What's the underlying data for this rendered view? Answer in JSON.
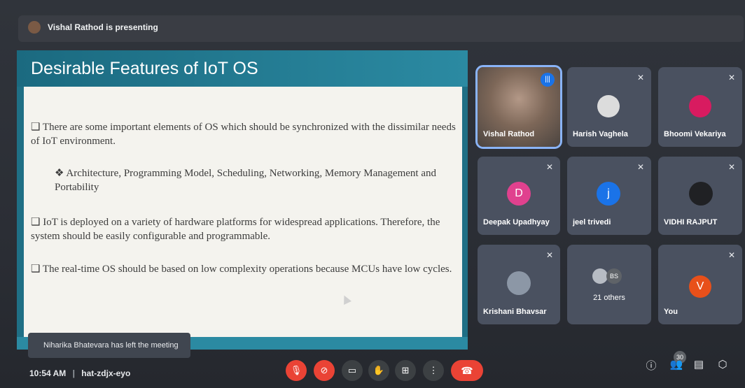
{
  "presenter_banner": {
    "text": "Vishal Rathod is presenting"
  },
  "slide": {
    "title": "Desirable Features of IoT OS",
    "paragraphs": [
      "❑ There are some important elements of OS which should be synchronized with the dissimilar needs of IoT environment.",
      "❖   Architecture, Programming Model, Scheduling, Networking, Memory Management and Portability",
      "❑ IoT is deployed on a variety of hardware platforms for widespread applications. Therefore, the system should be easily configurable and programmable.",
      "❑ The real-time OS should be based on low complexity operations because MCUs have low cycles."
    ]
  },
  "toast": {
    "text": "Niharika Bhatevara has left the meeting"
  },
  "participants": [
    {
      "name": "Vishal Rathod",
      "state": "speaking",
      "icon": "speaking-icon"
    },
    {
      "name": "Harish Vaghela",
      "state": "muted",
      "icon": "mic-off-icon"
    },
    {
      "name": "Bhoomi Vekariya",
      "state": "muted",
      "icon": "mic-off-icon"
    },
    {
      "name": "Deepak Upadhyay",
      "state": "muted",
      "initial": "D",
      "color": "#e8710a"
    },
    {
      "name": "jeel trivedi",
      "state": "muted",
      "initial": "j",
      "color": "#1a73e8"
    },
    {
      "name": "VIDHI RAJPUT",
      "state": "muted"
    },
    {
      "name": "Krishani Bhavsar",
      "state": "muted"
    },
    {
      "name": "21 others",
      "initials": "BS"
    },
    {
      "name": "You",
      "state": "muted",
      "initial": "V",
      "color": "#e8501a"
    }
  ],
  "bottom": {
    "time": "10:54 AM",
    "meeting_code": "hat-zdjx-eyo",
    "people_count": "30"
  },
  "colors": {
    "accent": "#8ab4f8",
    "danger": "#ea4335",
    "slide_teal": "#1f6f85"
  }
}
